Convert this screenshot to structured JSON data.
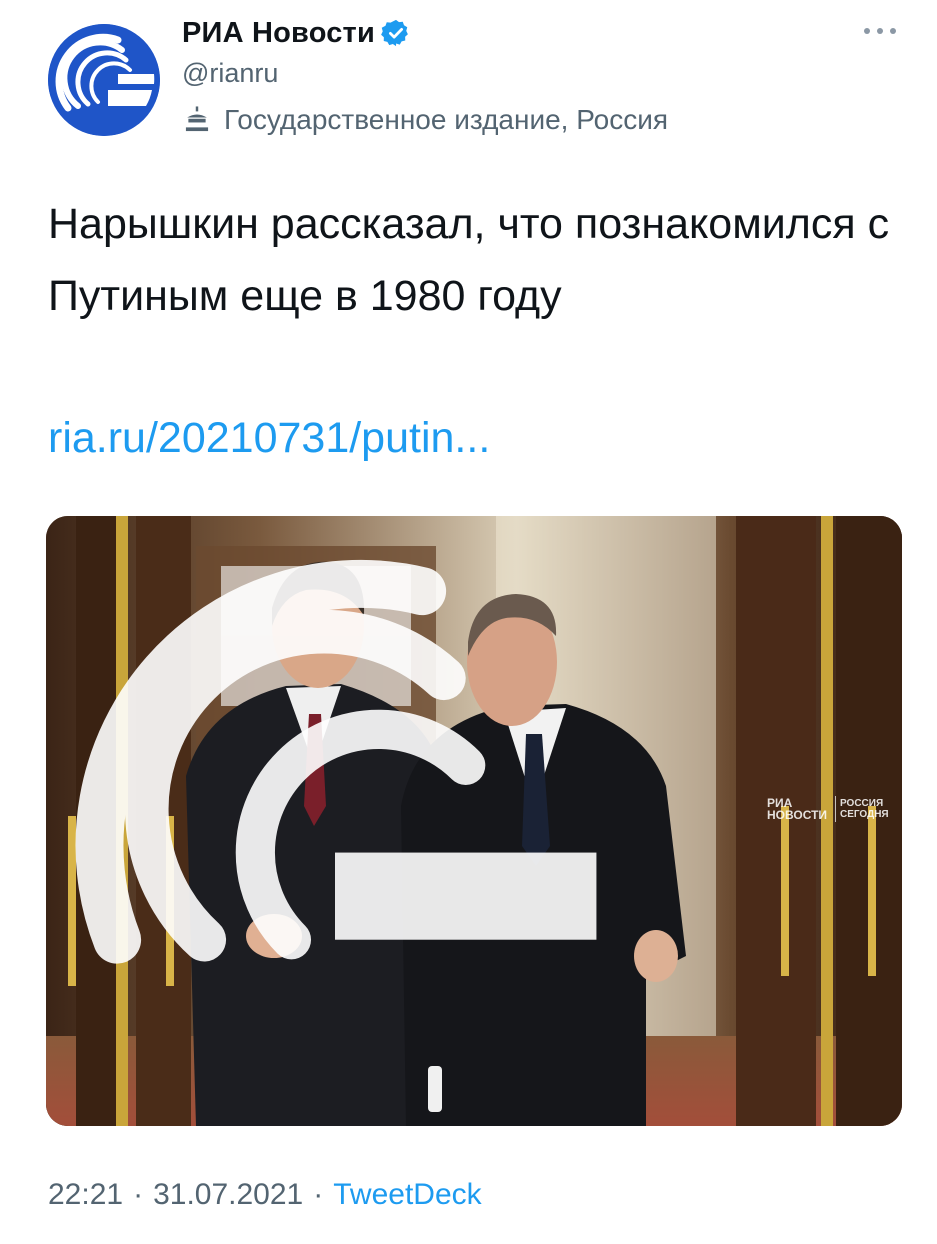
{
  "author": {
    "display_name": "РИА Новости",
    "handle": "@rianru",
    "label": "Государственное издание, Россия",
    "verified": true
  },
  "colors": {
    "accent": "#1d9bf0",
    "secondary_text": "#536471",
    "avatar_bg": "#1f55c8"
  },
  "icons": [
    "verified-icon",
    "government-building-icon",
    "more-options-icon",
    "ria-logo-icon"
  ],
  "tweet": {
    "text": "Нарышкин рассказал, что познакомился с Путиным еще в 1980 году",
    "link": "ria.ru/20210731/putin..."
  },
  "media": {
    "watermark_left_line1": "РИА",
    "watermark_left_line2": "НОВОСТИ",
    "watermark_right_line1": "РОССИЯ",
    "watermark_right_line2": "СЕГОДНЯ"
  },
  "meta": {
    "time": "22:21",
    "date": "31.07.2021",
    "separator": "·",
    "source": "TweetDeck"
  }
}
